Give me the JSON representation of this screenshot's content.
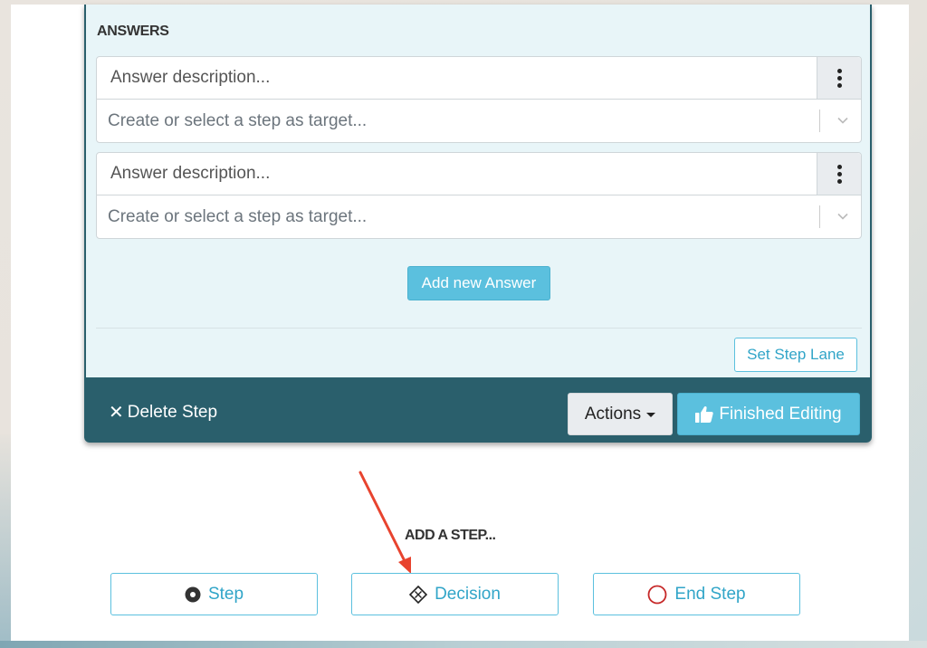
{
  "answers_section": {
    "title": "ANSWERS",
    "items": [
      {
        "description_placeholder": "Answer description...",
        "target_placeholder": "Create or select a step as target..."
      },
      {
        "description_placeholder": "Answer description...",
        "target_placeholder": "Create or select a step as target..."
      }
    ],
    "add_answer_label": "Add new Answer",
    "set_step_lane_label": "Set Step Lane"
  },
  "footer": {
    "delete_label": "Delete Step",
    "delete_icon": "x-icon",
    "actions_label": "Actions",
    "finished_label": "Finished Editing",
    "finished_icon": "thumbs-up-icon"
  },
  "add_step": {
    "title": "ADD A STEP...",
    "options": [
      {
        "label": "Step",
        "icon": "filled-circle-icon"
      },
      {
        "label": "Decision",
        "icon": "decision-diamond-icon"
      },
      {
        "label": "End Step",
        "icon": "open-circle-icon"
      }
    ]
  },
  "colors": {
    "accent": "#5bc0de",
    "footer": "#2a5f6c",
    "panel": "#e8f5f8",
    "annotation_arrow": "#e8432e",
    "end_circle": "#c62828"
  }
}
